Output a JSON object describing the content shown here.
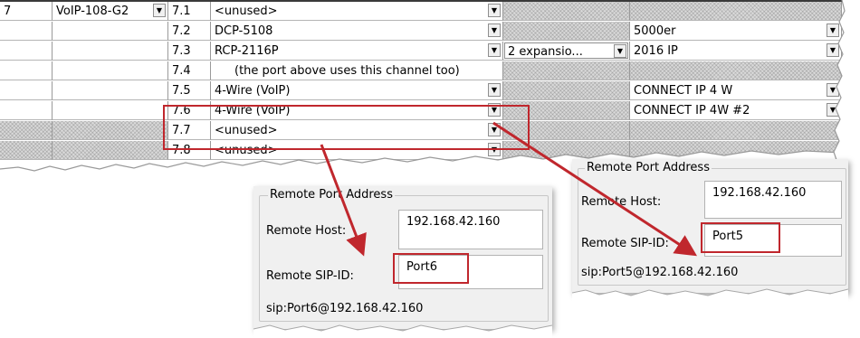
{
  "grid": {
    "colors": {
      "accent_red": "#c0272d",
      "hatch": "#d9d9d9"
    },
    "rows": [
      {
        "slot": "7",
        "module": "VoIP-108-G2",
        "channel": "7.1",
        "port": "<unused>",
        "expansion": "",
        "device": ""
      },
      {
        "slot": "",
        "module": "",
        "channel": "7.2",
        "port": "DCP-5108",
        "expansion": "",
        "device": "5000er"
      },
      {
        "slot": "",
        "module": "",
        "channel": "7.3",
        "port": "RCP-2116P",
        "expansion": "2 expansio...",
        "device": "2016 IP"
      },
      {
        "slot": "",
        "module": "",
        "channel": "7.4",
        "port": "(the port above uses this channel too)",
        "expansion": "",
        "device": ""
      },
      {
        "slot": "",
        "module": "",
        "channel": "7.5",
        "port": "4-Wire (VoIP)",
        "expansion": "",
        "device": "CONNECT IP 4 W"
      },
      {
        "slot": "",
        "module": "",
        "channel": "7.6",
        "port": "4-Wire (VoIP)",
        "expansion": "",
        "device": "CONNECT IP 4W #2"
      },
      {
        "slot": "",
        "module": "",
        "channel": "7.7",
        "port": "<unused>",
        "expansion": "",
        "device": ""
      },
      {
        "slot": "",
        "module": "",
        "channel": "7.8",
        "port": "<unused>",
        "expansion": "",
        "device": ""
      }
    ]
  },
  "panel_port5": {
    "group_title": "Remote Port Address",
    "host_label": "Remote Host:",
    "host_value": "192.168.42.160",
    "sip_label": "Remote SIP-ID:",
    "sip_value": "Port5",
    "uri": "sip:Port5@192.168.42.160"
  },
  "panel_port6": {
    "group_title": "Remote Port Address",
    "host_label": "Remote Host:",
    "host_value": "192.168.42.160",
    "sip_label": "Remote SIP-ID:",
    "sip_value": "Port6",
    "uri": "sip:Port6@192.168.42.160"
  }
}
